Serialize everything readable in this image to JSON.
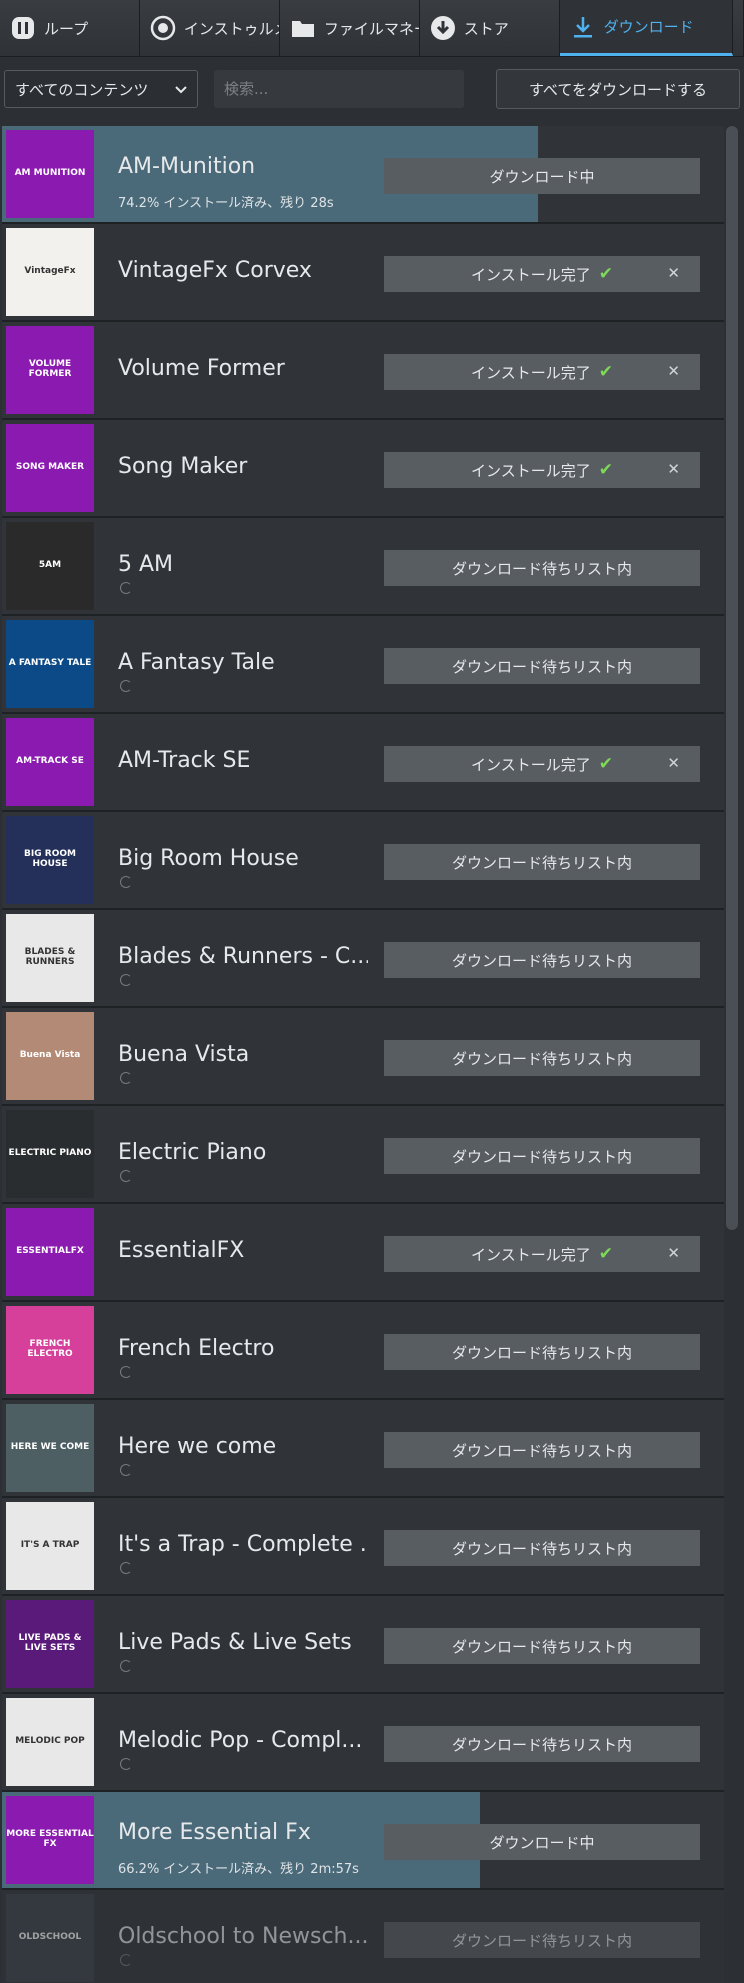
{
  "tabs": [
    {
      "label": "ループ",
      "icon": "loop-icon"
    },
    {
      "label": "インストゥルメ...",
      "icon": "instrument-icon"
    },
    {
      "label": "ファイルマネー...",
      "icon": "folder-icon"
    },
    {
      "label": "ストア",
      "icon": "store-icon"
    },
    {
      "label": "ダウンロード",
      "icon": "download-icon"
    }
  ],
  "toolbar": {
    "filter_value": "すべてのコンテンツ",
    "search_placeholder": "検索...",
    "download_all_label": "すべてをダウンロードする"
  },
  "items": [
    {
      "name": "AM-Munition",
      "sub": "74.2% インストール済み、残り 28s",
      "status": "ダウンロード中",
      "state": "downloading",
      "progress": 0.742,
      "thumb_text": "AM MUNITION",
      "thumb_color": "#8b1ab0"
    },
    {
      "name": "VintageFx Corvex",
      "status": "インストール完了",
      "state": "installed",
      "thumb_text": "VintageFx",
      "thumb_color": "#f3f1ee"
    },
    {
      "name": "Volume Former",
      "status": "インストール完了",
      "state": "installed",
      "thumb_text": "VOLUME FORMER",
      "thumb_color": "#8b1ab0"
    },
    {
      "name": "Song Maker",
      "status": "インストール完了",
      "state": "installed",
      "thumb_text": "SONG MAKER",
      "thumb_color": "#8b1ab0"
    },
    {
      "name": "5 AM",
      "status": "ダウンロード待ちリスト内",
      "state": "queued",
      "thumb_text": "5AM",
      "thumb_color": "#2a2a2a"
    },
    {
      "name": "A Fantasy Tale",
      "status": "ダウンロード待ちリスト内",
      "state": "queued",
      "thumb_text": "A FANTASY TALE",
      "thumb_color": "#0b4a86"
    },
    {
      "name": "AM-Track SE",
      "status": "インストール完了",
      "state": "installed",
      "thumb_text": "AM-TRACK SE",
      "thumb_color": "#8b1ab0"
    },
    {
      "name": "Big Room House",
      "status": "ダウンロード待ちリスト内",
      "state": "queued",
      "thumb_text": "BIG ROOM HOUSE",
      "thumb_color": "#24305a"
    },
    {
      "name": "Blades & Runners - C...",
      "status": "ダウンロード待ちリスト内",
      "state": "queued",
      "thumb_text": "BLADES & RUNNERS",
      "thumb_color": "#e8e8e8"
    },
    {
      "name": "Buena Vista",
      "status": "ダウンロード待ちリスト内",
      "state": "queued",
      "thumb_text": "Buena Vista",
      "thumb_color": "#b38a75"
    },
    {
      "name": "Electric Piano",
      "status": "ダウンロード待ちリスト内",
      "state": "queued",
      "thumb_text": "ELECTRIC PIANO",
      "thumb_color": "#2a2d30"
    },
    {
      "name": "EssentialFX",
      "status": "インストール完了",
      "state": "installed",
      "thumb_text": "ESSENTIALFX",
      "thumb_color": "#8b1ab0"
    },
    {
      "name": "French Electro",
      "status": "ダウンロード待ちリスト内",
      "state": "queued",
      "thumb_text": "FRENCH ELECTRO",
      "thumb_color": "#d63f9a"
    },
    {
      "name": "Here we come",
      "status": "ダウンロード待ちリスト内",
      "state": "queued",
      "thumb_text": "HERE WE COME",
      "thumb_color": "#4d5f63"
    },
    {
      "name": "It's a Trap - Complete ...",
      "status": "ダウンロード待ちリスト内",
      "state": "queued",
      "thumb_text": "IT'S A TRAP",
      "thumb_color": "#e8e8e8"
    },
    {
      "name": "Live Pads & Live Sets",
      "status": "ダウンロード待ちリスト内",
      "state": "queued",
      "thumb_text": "LIVE PADS & LIVE SETS",
      "thumb_color": "#5a1a7a"
    },
    {
      "name": "Melodic Pop - Compl...",
      "status": "ダウンロード待ちリスト内",
      "state": "queued",
      "thumb_text": "MELODIC POP",
      "thumb_color": "#e8e8e8"
    },
    {
      "name": "More Essential Fx",
      "sub": "66.2% インストール済み、残り 2m:57s",
      "status": "ダウンロード中",
      "state": "downloading",
      "progress": 0.662,
      "thumb_text": "MORE ESSENTIAL FX",
      "thumb_color": "#8b1ab0"
    },
    {
      "name": "Oldschool to Newsch...",
      "status": "ダウンロード待ちリスト内",
      "state": "queued",
      "dim": true,
      "thumb_text": "OLDSCHOOL",
      "thumb_color": "#3a4248"
    }
  ]
}
